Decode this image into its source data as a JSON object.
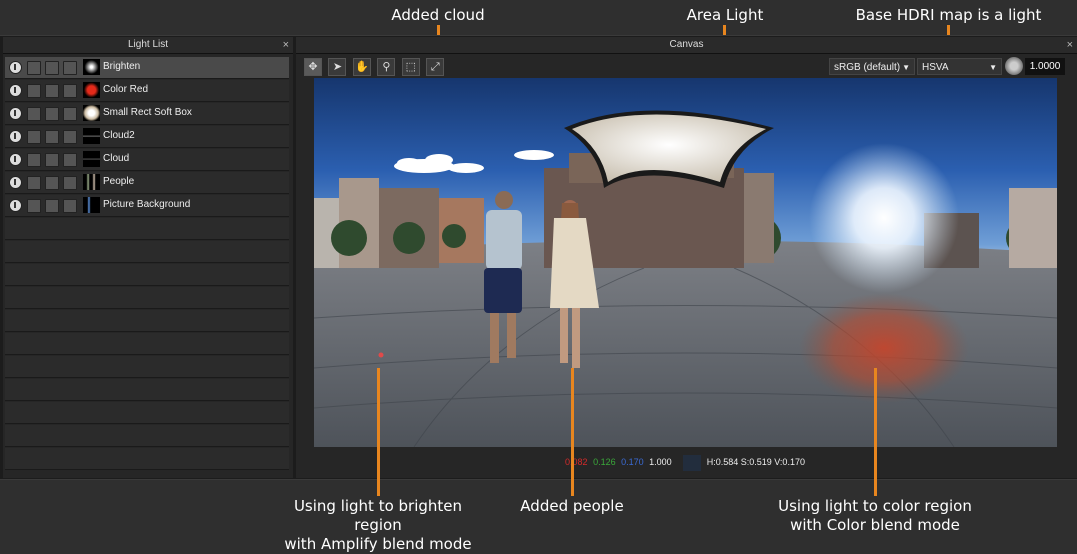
{
  "callouts": {
    "added_cloud": "Added cloud",
    "area_light": "Area Light",
    "base_hdri": "Base HDRI map is a light",
    "brighten_region": "Using light to brighten region\nwith Amplify blend mode",
    "added_people": "Added people",
    "color_region": "Using light to color region\nwith Color blend mode"
  },
  "light_list": {
    "title": "Light List",
    "close": "×",
    "items": [
      {
        "label": "Brighten",
        "selected": true
      },
      {
        "label": "Color Red"
      },
      {
        "label": "Small Rect Soft Box"
      },
      {
        "label": "Cloud2"
      },
      {
        "label": "Cloud"
      },
      {
        "label": "People"
      },
      {
        "label": "Picture Background"
      }
    ]
  },
  "canvas": {
    "title": "Canvas",
    "close": "×",
    "color_space": "sRGB (default)",
    "color_mode": "HSVA",
    "exposure": "1.0000"
  },
  "status": {
    "r": "0.082",
    "g": "0.126",
    "b": "0.170",
    "a": "1.000",
    "hsv": "H:0.584 S:0.519 V:0.170"
  },
  "colors": {
    "accent": "#e8861f",
    "r_text": "#d42a2a",
    "g_text": "#3aa83a",
    "b_text": "#3a6ad4"
  }
}
